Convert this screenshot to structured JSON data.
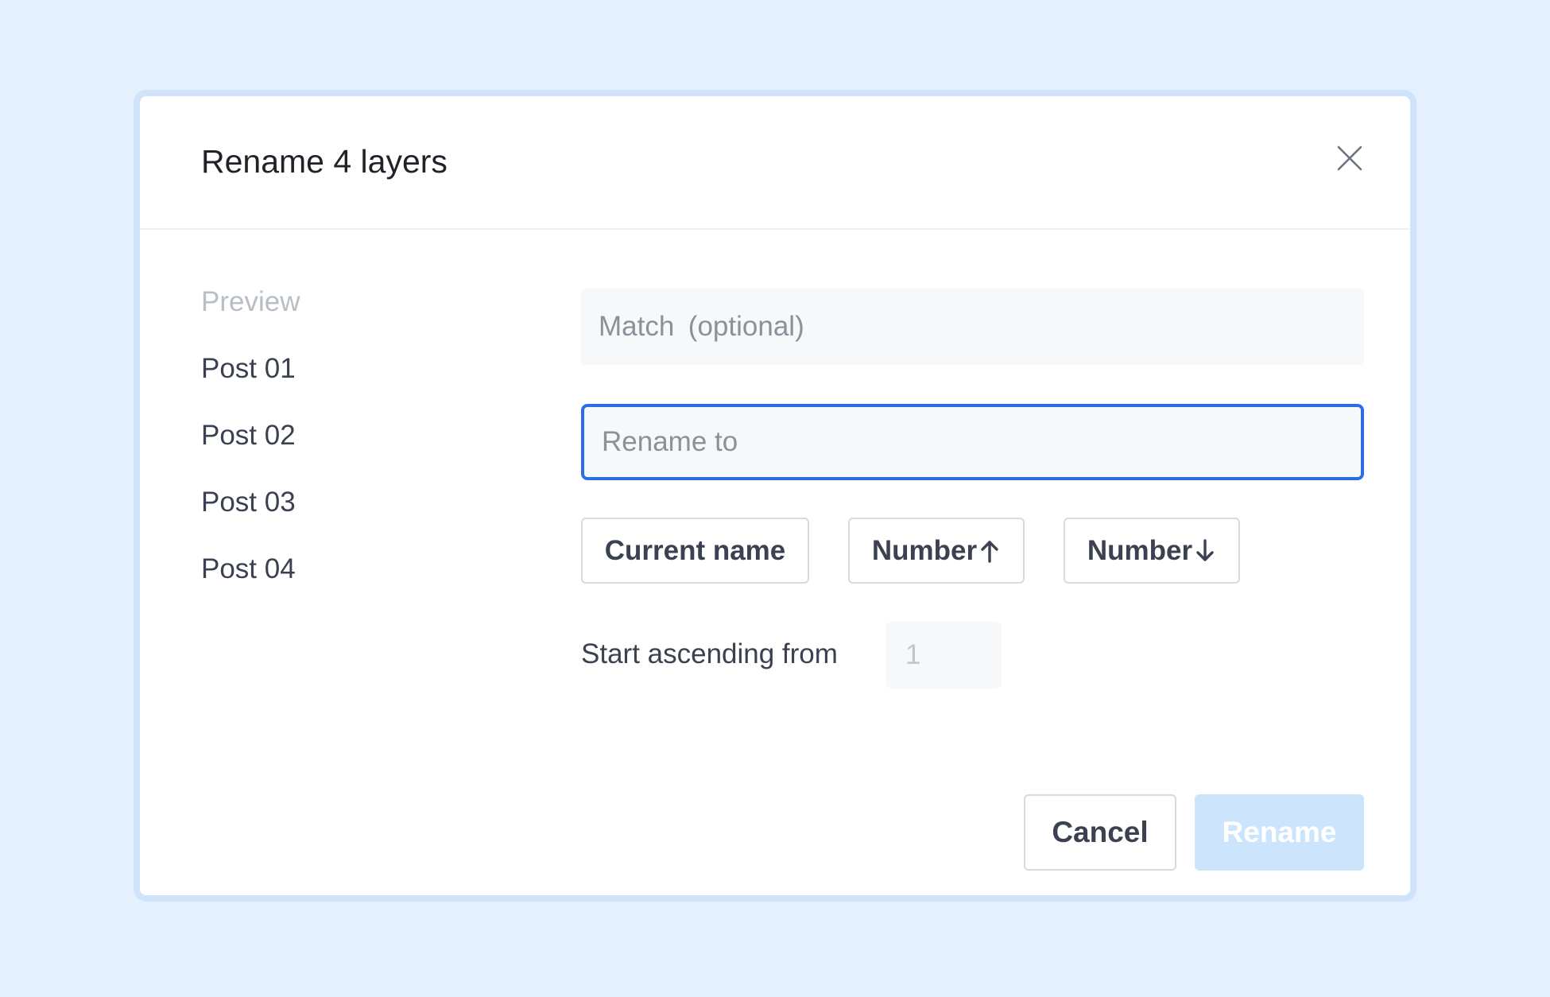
{
  "dialog": {
    "title": "Rename 4 layers",
    "close_icon": "close-icon"
  },
  "preview": {
    "label": "Preview",
    "items": [
      "Post 01",
      "Post 02",
      "Post 03",
      "Post 04"
    ]
  },
  "form": {
    "match_placeholder": "Match (optional)",
    "rename_placeholder": "Rename to",
    "tokens": [
      {
        "label": "Current name",
        "icon": ""
      },
      {
        "label": "Number",
        "icon": "arrow-up-icon"
      },
      {
        "label": "Number",
        "icon": "arrow-down-icon"
      }
    ],
    "start_label": "Start ascending from",
    "start_placeholder": "1"
  },
  "actions": {
    "cancel_label": "Cancel",
    "rename_label": "Rename"
  },
  "colors": {
    "background": "#e5f0fe",
    "accent": "#2b6ee6",
    "disabled_primary": "#cce4fc"
  }
}
